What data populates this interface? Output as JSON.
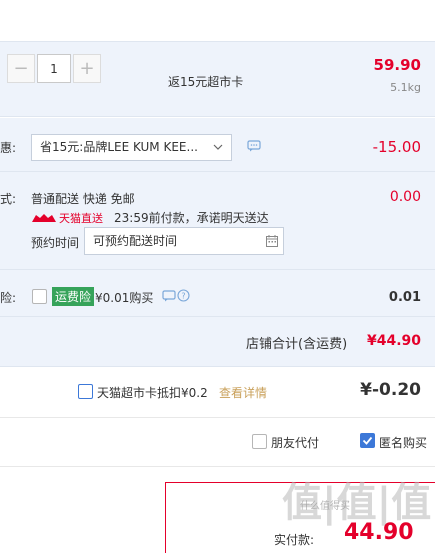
{
  "item": {
    "quantity": "1",
    "minus_label": "−",
    "plus_label": "+",
    "rebate_text": "返15元超市卡",
    "price": "59.90",
    "weight": "5.1kg"
  },
  "discount_row": {
    "label": "惠:",
    "select_value": "省15元:品牌LEE KUM KEE...",
    "amount": "-15.00"
  },
  "shipping_row": {
    "label": "式:",
    "method": "普通配送 快递 免邮",
    "fee": "0.00",
    "tmall_badge": "天猫直送",
    "promise": "23:59前付款，承诺明天送达",
    "appt_label": "预约时间",
    "appt_placeholder": "可预约配送时间"
  },
  "insurance_row": {
    "label": "险:",
    "badge": "运费险",
    "text": "¥0.01购买",
    "fee": "0.01"
  },
  "shop_total": {
    "label": "店铺合计(含运费)",
    "amount": "¥44.90"
  },
  "supermarket_card": {
    "text": "天猫超市卡抵扣¥0.2",
    "link": "查看详情",
    "amount": "¥-0.20"
  },
  "options": {
    "friend_pay": "朋友代付",
    "anonymous": "匿名购买"
  },
  "payment": {
    "label": "实付款:",
    "amount": "44.90",
    "watermark": "值|值|值",
    "watermark_sub": "什么值得买"
  },
  "colors": {
    "accent_red": "#e4002b",
    "panel_blue": "#eef3fb",
    "link_gold": "#c9a05a",
    "check_blue": "#3c78d8"
  }
}
